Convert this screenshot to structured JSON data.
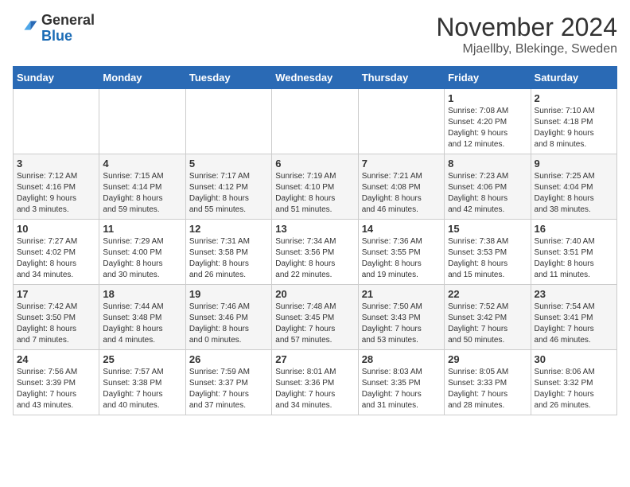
{
  "header": {
    "logo_line1": "General",
    "logo_line2": "Blue",
    "month": "November 2024",
    "location": "Mjaellby, Blekinge, Sweden"
  },
  "weekdays": [
    "Sunday",
    "Monday",
    "Tuesday",
    "Wednesday",
    "Thursday",
    "Friday",
    "Saturday"
  ],
  "weeks": [
    [
      {
        "day": "",
        "info": ""
      },
      {
        "day": "",
        "info": ""
      },
      {
        "day": "",
        "info": ""
      },
      {
        "day": "",
        "info": ""
      },
      {
        "day": "",
        "info": ""
      },
      {
        "day": "1",
        "info": "Sunrise: 7:08 AM\nSunset: 4:20 PM\nDaylight: 9 hours\nand 12 minutes."
      },
      {
        "day": "2",
        "info": "Sunrise: 7:10 AM\nSunset: 4:18 PM\nDaylight: 9 hours\nand 8 minutes."
      }
    ],
    [
      {
        "day": "3",
        "info": "Sunrise: 7:12 AM\nSunset: 4:16 PM\nDaylight: 9 hours\nand 3 minutes."
      },
      {
        "day": "4",
        "info": "Sunrise: 7:15 AM\nSunset: 4:14 PM\nDaylight: 8 hours\nand 59 minutes."
      },
      {
        "day": "5",
        "info": "Sunrise: 7:17 AM\nSunset: 4:12 PM\nDaylight: 8 hours\nand 55 minutes."
      },
      {
        "day": "6",
        "info": "Sunrise: 7:19 AM\nSunset: 4:10 PM\nDaylight: 8 hours\nand 51 minutes."
      },
      {
        "day": "7",
        "info": "Sunrise: 7:21 AM\nSunset: 4:08 PM\nDaylight: 8 hours\nand 46 minutes."
      },
      {
        "day": "8",
        "info": "Sunrise: 7:23 AM\nSunset: 4:06 PM\nDaylight: 8 hours\nand 42 minutes."
      },
      {
        "day": "9",
        "info": "Sunrise: 7:25 AM\nSunset: 4:04 PM\nDaylight: 8 hours\nand 38 minutes."
      }
    ],
    [
      {
        "day": "10",
        "info": "Sunrise: 7:27 AM\nSunset: 4:02 PM\nDaylight: 8 hours\nand 34 minutes."
      },
      {
        "day": "11",
        "info": "Sunrise: 7:29 AM\nSunset: 4:00 PM\nDaylight: 8 hours\nand 30 minutes."
      },
      {
        "day": "12",
        "info": "Sunrise: 7:31 AM\nSunset: 3:58 PM\nDaylight: 8 hours\nand 26 minutes."
      },
      {
        "day": "13",
        "info": "Sunrise: 7:34 AM\nSunset: 3:56 PM\nDaylight: 8 hours\nand 22 minutes."
      },
      {
        "day": "14",
        "info": "Sunrise: 7:36 AM\nSunset: 3:55 PM\nDaylight: 8 hours\nand 19 minutes."
      },
      {
        "day": "15",
        "info": "Sunrise: 7:38 AM\nSunset: 3:53 PM\nDaylight: 8 hours\nand 15 minutes."
      },
      {
        "day": "16",
        "info": "Sunrise: 7:40 AM\nSunset: 3:51 PM\nDaylight: 8 hours\nand 11 minutes."
      }
    ],
    [
      {
        "day": "17",
        "info": "Sunrise: 7:42 AM\nSunset: 3:50 PM\nDaylight: 8 hours\nand 7 minutes."
      },
      {
        "day": "18",
        "info": "Sunrise: 7:44 AM\nSunset: 3:48 PM\nDaylight: 8 hours\nand 4 minutes."
      },
      {
        "day": "19",
        "info": "Sunrise: 7:46 AM\nSunset: 3:46 PM\nDaylight: 8 hours\nand 0 minutes."
      },
      {
        "day": "20",
        "info": "Sunrise: 7:48 AM\nSunset: 3:45 PM\nDaylight: 7 hours\nand 57 minutes."
      },
      {
        "day": "21",
        "info": "Sunrise: 7:50 AM\nSunset: 3:43 PM\nDaylight: 7 hours\nand 53 minutes."
      },
      {
        "day": "22",
        "info": "Sunrise: 7:52 AM\nSunset: 3:42 PM\nDaylight: 7 hours\nand 50 minutes."
      },
      {
        "day": "23",
        "info": "Sunrise: 7:54 AM\nSunset: 3:41 PM\nDaylight: 7 hours\nand 46 minutes."
      }
    ],
    [
      {
        "day": "24",
        "info": "Sunrise: 7:56 AM\nSunset: 3:39 PM\nDaylight: 7 hours\nand 43 minutes."
      },
      {
        "day": "25",
        "info": "Sunrise: 7:57 AM\nSunset: 3:38 PM\nDaylight: 7 hours\nand 40 minutes."
      },
      {
        "day": "26",
        "info": "Sunrise: 7:59 AM\nSunset: 3:37 PM\nDaylight: 7 hours\nand 37 minutes."
      },
      {
        "day": "27",
        "info": "Sunrise: 8:01 AM\nSunset: 3:36 PM\nDaylight: 7 hours\nand 34 minutes."
      },
      {
        "day": "28",
        "info": "Sunrise: 8:03 AM\nSunset: 3:35 PM\nDaylight: 7 hours\nand 31 minutes."
      },
      {
        "day": "29",
        "info": "Sunrise: 8:05 AM\nSunset: 3:33 PM\nDaylight: 7 hours\nand 28 minutes."
      },
      {
        "day": "30",
        "info": "Sunrise: 8:06 AM\nSunset: 3:32 PM\nDaylight: 7 hours\nand 26 minutes."
      }
    ]
  ]
}
